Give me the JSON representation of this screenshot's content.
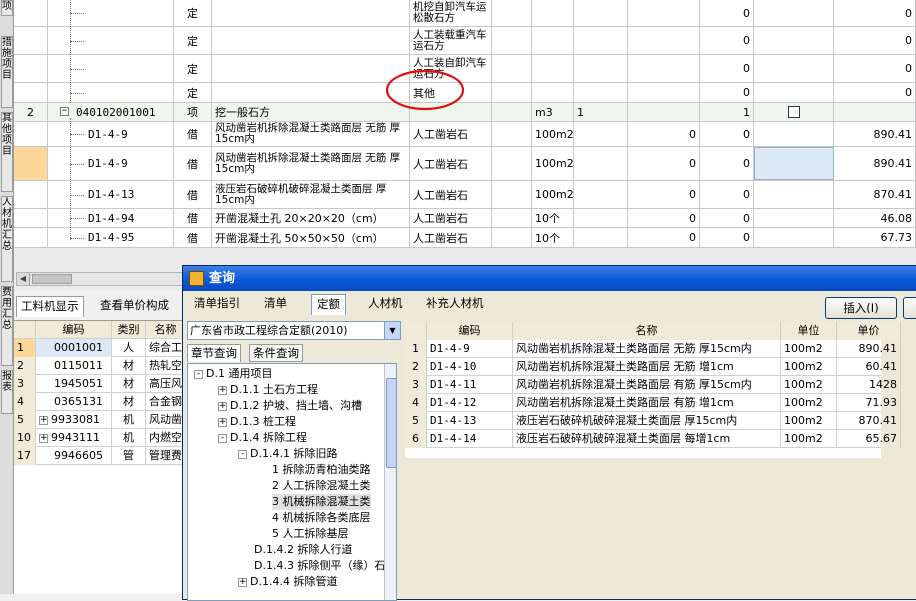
{
  "left_strip": {
    "tabs": [
      "项",
      "措施项目",
      "其他项目",
      "人材机汇总",
      "费用汇总",
      "报表"
    ]
  },
  "main_grid": {
    "rows": [
      {
        "code": "",
        "type": "定",
        "name": "",
        "spec": "机挖自卸汽车运松散石方",
        "unit": "",
        "qty": "",
        "c1": "",
        "c2": "0",
        "price": "0"
      },
      {
        "code": "",
        "type": "定",
        "name": "",
        "spec": "人工装载重汽车运石方",
        "unit": "",
        "qty": "",
        "c1": "",
        "c2": "0",
        "price": "0"
      },
      {
        "code": "",
        "type": "定",
        "name": "",
        "spec": "人工装自卸汽车运石方",
        "unit": "",
        "qty": "",
        "c1": "",
        "c2": "0",
        "price": "0"
      },
      {
        "code": "",
        "type": "定",
        "name": "",
        "spec": "其他",
        "unit": "",
        "qty": "",
        "c1": "",
        "c2": "0",
        "price": "0"
      },
      {
        "seq": "2",
        "code": "040102001001",
        "type": "项",
        "name": "挖一般石方",
        "spec": "",
        "unit": "m3",
        "qty": "1",
        "c1": "",
        "c2": "1",
        "price": "0"
      },
      {
        "code": "D1-4-9",
        "type": "借",
        "name": "风动凿岩机拆除混凝土类路面层 无筋 厚15cm内",
        "spec": "人工凿岩石",
        "unit": "100m2",
        "qty": "",
        "c1": "0",
        "c2": "0",
        "price": "890.41"
      },
      {
        "code": "D1-4-9",
        "type": "借",
        "name": "风动凿岩机拆除混凝土类路面层 无筋 厚15cm内",
        "spec": "人工凿岩石",
        "unit": "100m2",
        "qty": "",
        "c1": "0",
        "c2": "0",
        "price": "890.41"
      },
      {
        "code": "D1-4-13",
        "type": "借",
        "name": "液压岩石破碎机破碎混凝土类面层 厚15cm内",
        "spec": "人工凿岩石",
        "unit": "100m2",
        "qty": "",
        "c1": "0",
        "c2": "0",
        "price": "870.41"
      },
      {
        "code": "D1-4-94",
        "type": "借",
        "name": "开凿混凝土孔 20×20×20（cm）",
        "spec": "人工凿岩石",
        "unit": "10个",
        "qty": "",
        "c1": "0",
        "c2": "0",
        "price": "46.08"
      },
      {
        "code": "D1-4-95",
        "type": "借",
        "name": "开凿混凝土孔 50×50×50（cm）",
        "spec": "人工凿岩石",
        "unit": "10个",
        "qty": "",
        "c1": "0",
        "c2": "0",
        "price": "67.73"
      }
    ]
  },
  "resource_tabs": {
    "tab1": "工料机显示",
    "tab2": "查看单价构成"
  },
  "resource_grid": {
    "headers": {
      "code": "编码",
      "type": "类别",
      "name": "名称"
    },
    "rows": [
      {
        "n": "1",
        "expander": "",
        "code": "0001001",
        "type": "人",
        "name": "综合工日"
      },
      {
        "n": "2",
        "expander": "",
        "code": "0115011",
        "type": "材",
        "name": "热轧空心钢"
      },
      {
        "n": "3",
        "expander": "",
        "code": "1945051",
        "type": "材",
        "name": "高压风管"
      },
      {
        "n": "4",
        "expander": "",
        "code": "0365131",
        "type": "材",
        "name": "合金钢钻头"
      },
      {
        "n": "5",
        "expander": "+",
        "code": "9933081",
        "type": "机",
        "name": "风动凿岩机"
      },
      {
        "n": "10",
        "expander": "+",
        "code": "9943111",
        "type": "机",
        "name": "内燃空气压缩机"
      },
      {
        "n": "17",
        "expander": "",
        "code": "9946605",
        "type": "管",
        "name": "管理费"
      }
    ]
  },
  "dialog": {
    "title": "查询",
    "tabs": [
      "清单指引",
      "清单",
      "定额",
      "人材机",
      "补充人材机"
    ],
    "insert_button": "插入(I)",
    "quota_set": "广东省市政工程综合定额(2010)",
    "tree_tabs": [
      "章节查询",
      "条件查询"
    ],
    "tree": [
      {
        "label": "D.1 通用项目",
        "exp": "-"
      },
      {
        "label": "D.1.1 土石方工程",
        "exp": "+"
      },
      {
        "label": "D.1.2 护坡、挡土墙、沟槽",
        "exp": "+"
      },
      {
        "label": "D.1.3 桩工程",
        "exp": "+"
      },
      {
        "label": "D.1.4  拆除工程",
        "exp": "-"
      },
      {
        "label": "D.1.4.1 拆除旧路",
        "exp": "-"
      },
      {
        "label": "1 拆除沥青柏油类路",
        "exp": ""
      },
      {
        "label": "2 人工拆除混凝土类",
        "exp": ""
      },
      {
        "label": "3 机械拆除混凝土类",
        "exp": ""
      },
      {
        "label": "4 机械拆除各类底层",
        "exp": ""
      },
      {
        "label": "5 人工拆除基层",
        "exp": ""
      },
      {
        "label": "D.1.4.2 拆除人行道",
        "exp": ""
      },
      {
        "label": "D.1.4.3 拆除侧平（缘）石",
        "exp": ""
      },
      {
        "label": "D.1.4.4 拆除管道",
        "exp": "+"
      }
    ],
    "quota_table": {
      "headers": {
        "code": "编码",
        "name": "名称",
        "unit": "单位",
        "price": "单价"
      },
      "rows": [
        {
          "n": "1",
          "code": "D1-4-9",
          "name": "风动凿岩机拆除混凝土类路面层 无筋 厚15cm内",
          "unit": "100m2",
          "price": "890.41"
        },
        {
          "n": "2",
          "code": "D1-4-10",
          "name": "风动凿岩机拆除混凝土类路面层 无筋 增1cm",
          "unit": "100m2",
          "price": "60.41"
        },
        {
          "n": "3",
          "code": "D1-4-11",
          "name": "风动凿岩机拆除混凝土类路面层 有筋 厚15cm内",
          "unit": "100m2",
          "price": "1428"
        },
        {
          "n": "4",
          "code": "D1-4-12",
          "name": "风动凿岩机拆除混凝土类路面层 有筋 增1cm",
          "unit": "100m2",
          "price": "71.93"
        },
        {
          "n": "5",
          "code": "D1-4-13",
          "name": "液压岩石破碎机破碎混凝土类面层 厚15cm内",
          "unit": "100m2",
          "price": "870.41"
        },
        {
          "n": "6",
          "code": "D1-4-14",
          "name": "液压岩石破碎机破碎混凝土类面层 每增1cm",
          "unit": "100m2",
          "price": "65.67"
        }
      ]
    }
  },
  "colors": {
    "annotation": "#e01010",
    "selected_cell": "#dde8f5",
    "title_bar": "#0a5ad8",
    "row_seq_highlight": "#fbd79a"
  }
}
